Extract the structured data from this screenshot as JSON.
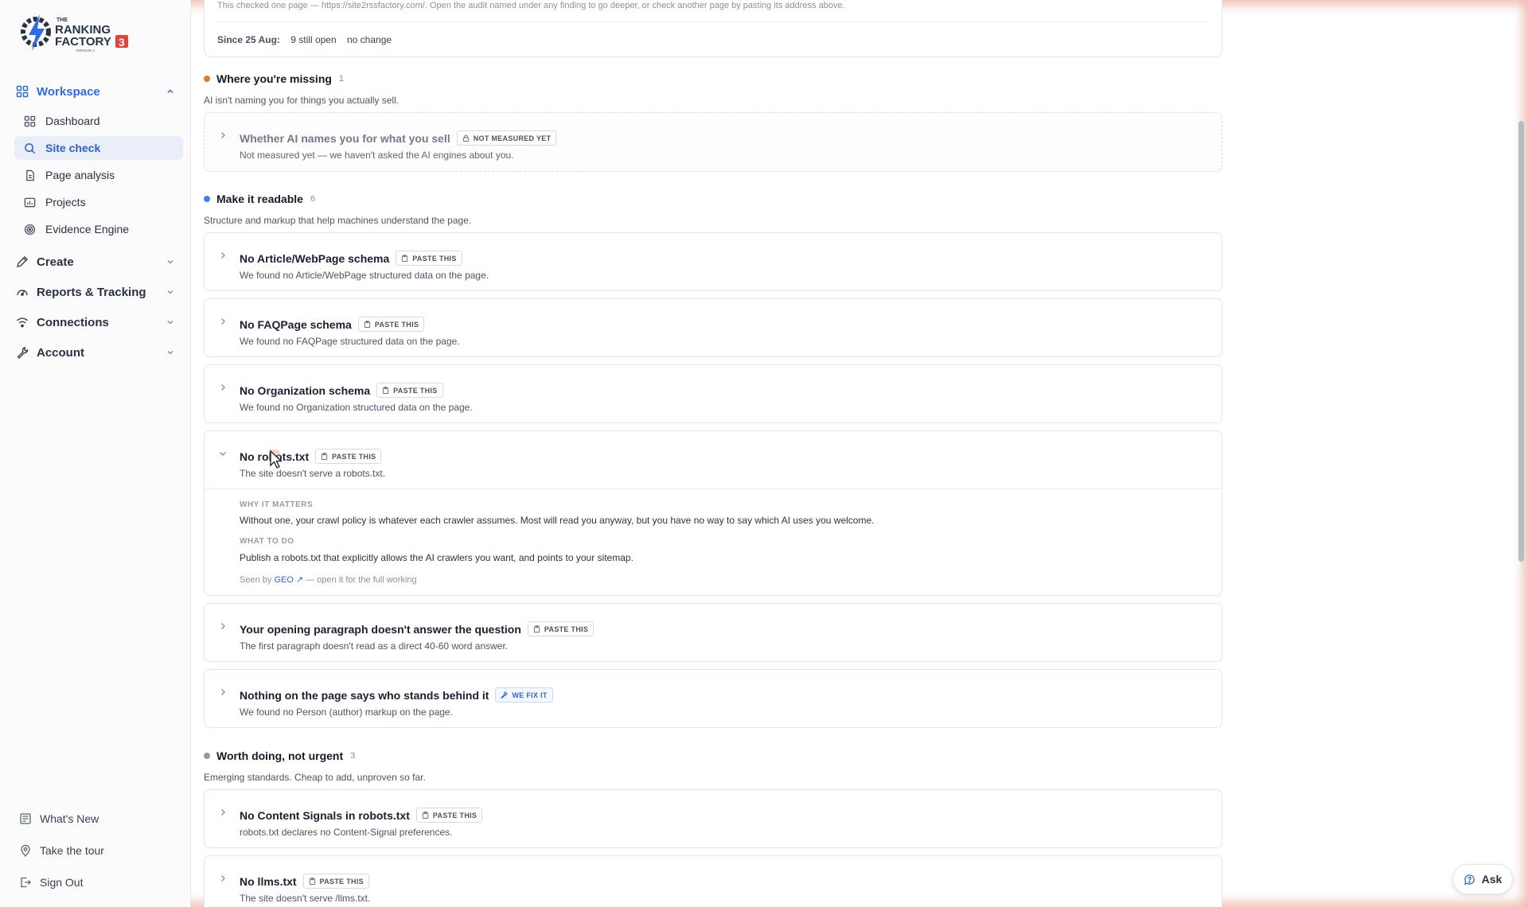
{
  "brand": {
    "logo_line1": "THE",
    "logo_line2": "RANKING",
    "logo_line3": "FACTORY",
    "logo_badge": "3",
    "logo_version": "VERSION 3"
  },
  "sidebar": {
    "groups": [
      {
        "label": "Workspace",
        "icon": "grid-icon",
        "open": true
      },
      {
        "label": "Create",
        "icon": "pen-icon"
      },
      {
        "label": "Reports & Tracking",
        "icon": "gauge-icon"
      },
      {
        "label": "Connections",
        "icon": "wifi-icon"
      },
      {
        "label": "Account",
        "icon": "wrench-icon"
      }
    ],
    "items": [
      {
        "label": "Dashboard",
        "icon": "grid-icon"
      },
      {
        "label": "Site check",
        "icon": "search-icon",
        "active": true
      },
      {
        "label": "Page analysis",
        "icon": "document-icon"
      },
      {
        "label": "Projects",
        "icon": "folder-chart-icon"
      },
      {
        "label": "Evidence Engine",
        "icon": "target-icon"
      }
    ],
    "bottom": [
      {
        "label": "What's New",
        "icon": "newspaper-icon"
      },
      {
        "label": "Take the tour",
        "icon": "map-pin-icon"
      },
      {
        "label": "Sign Out",
        "icon": "sign-out-icon"
      }
    ]
  },
  "summary": {
    "note": "This checked one page — https://site2rssfactory.com/. Open the audit named under any finding to go deeper, or check another page by pasting its address above.",
    "since_label": "Since 25 Aug:",
    "still_open": "9 still open",
    "change": "no change"
  },
  "sections": {
    "missing": {
      "title": "Where you're missing",
      "count": "1",
      "subtitle": "AI isn't naming you for things you actually sell.",
      "color": "#e0782f",
      "findings": [
        {
          "title": "Whether AI names you for what you sell",
          "badge": "NOT MEASURED YET",
          "badge_icon": "lock-icon",
          "desc": "Not measured yet — we haven't asked the AI engines about you."
        }
      ]
    },
    "readable": {
      "title": "Make it readable",
      "count": "6",
      "subtitle": "Structure and markup that help machines understand the page.",
      "color": "#3b82f6",
      "findings": [
        {
          "title": "No Article/WebPage schema",
          "badge": "PASTE THIS",
          "badge_icon": "clipboard-icon",
          "desc": "We found no Article/WebPage structured data on the page."
        },
        {
          "title": "No FAQPage schema",
          "badge": "PASTE THIS",
          "badge_icon": "clipboard-icon",
          "desc": "We found no FAQPage structured data on the page."
        },
        {
          "title": "No Organization schema",
          "badge": "PASTE THIS",
          "badge_icon": "clipboard-icon",
          "desc": "We found no Organization structured data on the page."
        },
        {
          "title": "No robots.txt",
          "badge": "PASTE THIS",
          "badge_icon": "clipboard-icon",
          "desc": "The site doesn't serve a robots.txt.",
          "why_heading": "WHY IT MATTERS",
          "why_text": "Without one, your crawl policy is whatever each crawler assumes. Most will read you anyway, but you have no way to say which AI uses you welcome.",
          "todo_heading": "WHAT TO DO",
          "todo_text": "Publish a robots.txt that explicitly allows the AI crawlers you want, and points to your sitemap.",
          "seen_prefix": "Seen by",
          "seen_link": "GEO ↗",
          "seen_suffix": "— open it for the full working"
        },
        {
          "title": "Your opening paragraph doesn't answer the question",
          "badge": "PASTE THIS",
          "badge_icon": "clipboard-icon",
          "desc": "The first paragraph doesn't read as a direct 40-60 word answer."
        },
        {
          "title": "Nothing on the page says who stands behind it",
          "badge": "WE FIX IT",
          "badge_icon": "wrench-icon",
          "desc": "We found no Person (author) markup on the page."
        }
      ]
    },
    "worth": {
      "title": "Worth doing, not urgent",
      "count": "3",
      "subtitle": "Emerging standards. Cheap to add, unproven so far.",
      "color": "#9a9a9a",
      "findings": [
        {
          "title": "No Content Signals in robots.txt",
          "badge": "PASTE THIS",
          "badge_icon": "clipboard-icon",
          "desc": "robots.txt declares no Content-Signal preferences."
        },
        {
          "title": "No llms.txt",
          "badge": "PASTE THIS",
          "badge_icon": "clipboard-icon",
          "desc": "The site doesn't serve /llms.txt."
        }
      ]
    }
  },
  "ask": {
    "label": "Ask",
    "icon": "chat-icon"
  }
}
